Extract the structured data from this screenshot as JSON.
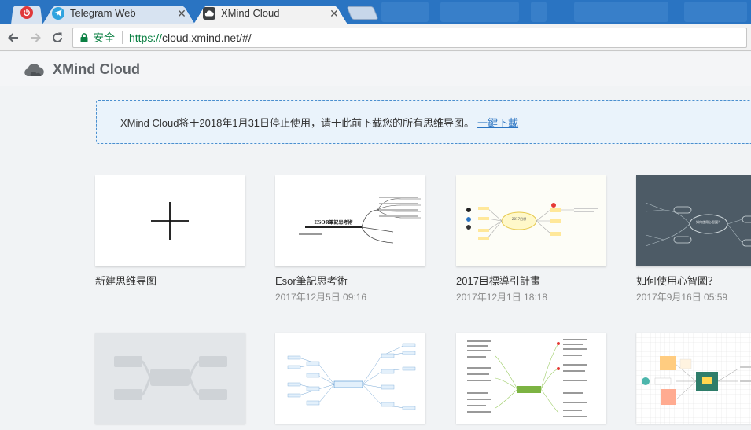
{
  "browser": {
    "tabs": [
      {
        "title": "Telegram Web",
        "icon": "telegram-icon"
      },
      {
        "title": "XMind Cloud",
        "icon": "xmind-icon",
        "active": true
      }
    ],
    "pinned_tab_icon": "power-icon",
    "toolbar": {
      "secure_label": "安全",
      "url_scheme": "https://",
      "url_rest": "cloud.xmind.net/#/"
    }
  },
  "app": {
    "brand": "XMind Cloud",
    "notice": {
      "text": "XMind Cloud将于2018年1月31日停止使用，请于此前下载您的所有思维导图。",
      "link_label": "一鍵下載"
    },
    "maps": [
      {
        "name": "新建思维导图",
        "date": "",
        "kind": "new"
      },
      {
        "name": "Esor筆記思考術",
        "date": "2017年12月5日 09:16",
        "kind": "tree"
      },
      {
        "name": "2017目標導引計畫",
        "date": "2017年12月1日 18:18",
        "kind": "radial"
      },
      {
        "name": "如何使用心智圖？",
        "date": "2017年9月16日 05:59",
        "kind": "dark"
      },
      {
        "name": "",
        "date": "",
        "kind": "placeholder"
      },
      {
        "name": "",
        "date": "",
        "kind": "blue-tree"
      },
      {
        "name": "",
        "date": "",
        "kind": "green-radial"
      },
      {
        "name": "",
        "date": "",
        "kind": "picture"
      }
    ],
    "thumb_labels": {
      "esor_center": "ESOR筆記思考術",
      "goal_center": "2017目標",
      "dark_center": "如何使用心智圖？"
    }
  },
  "colors": {
    "tabstrip": "#2a74c2",
    "accent": "#2a74c2",
    "secure_green": "#0b8043",
    "dark_thumb": "#4d5b66"
  }
}
